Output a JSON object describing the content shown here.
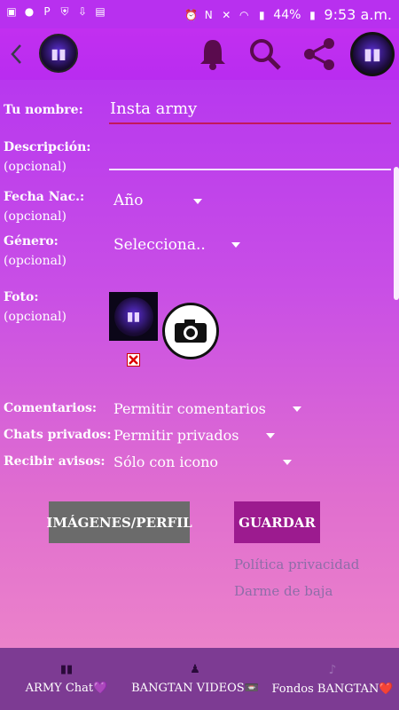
{
  "status": {
    "battery": "44%",
    "time": "9:53 a.m."
  },
  "form": {
    "name_label": "Tu nombre:",
    "name_value": "Insta army",
    "desc_label": "Descripción:",
    "optional": "(opcional)",
    "date_label": "Fecha Nac.:",
    "date_value": "Año",
    "gender_label": "Género:",
    "gender_value": "Selecciona..",
    "photo_label": "Foto:",
    "comments_label": "Comentarios:",
    "comments_value": "Permitir comentarios",
    "private_label": "Chats privados:",
    "private_value": "Permitir privados",
    "notify_label": "Recibir avisos:",
    "notify_value": "Sólo con icono"
  },
  "buttons": {
    "images_profile": "IMÁGENES/PERFIL",
    "save": "GUARDAR"
  },
  "links": {
    "privacy": "Política privacidad",
    "unsubscribe": "Darme de baja"
  },
  "bottom_nav": [
    {
      "label": "ARMY Chat💜",
      "icon": "bts-logo-icon"
    },
    {
      "label": "BANGTAN VIDEOS📼",
      "icon": "person-icon"
    },
    {
      "label": "Fondos BANGTAN❤️",
      "icon": "note-icon"
    }
  ],
  "colors": {
    "bg_top": "#b12ff2",
    "bg_bottom": "#f08ac8",
    "underline_active": "#c2185b",
    "images_button": "#6b6b6b",
    "save_button": "#9c1b8f",
    "bottom_bar": "#7d3b93"
  }
}
